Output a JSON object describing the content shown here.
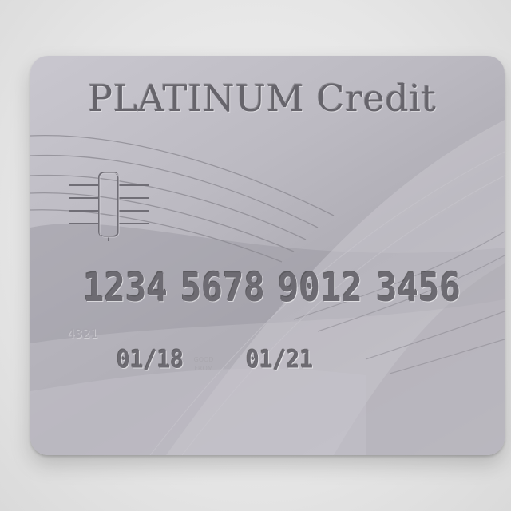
{
  "card": {
    "title": "PLATINUM Credit",
    "number_groups": [
      "1234",
      "5678",
      "9012",
      "3456"
    ],
    "bin": "4321",
    "valid_from": "01/18",
    "expires": "01/21",
    "good_from_label": [
      "GOOD",
      "FROM"
    ]
  },
  "icons": {
    "chip": "emv-chip-icon"
  },
  "colors": {
    "background": "#e6e6e6",
    "card_base": "#bcbac2",
    "emboss_text": "#6d6b72",
    "title_text": "#66646b"
  }
}
